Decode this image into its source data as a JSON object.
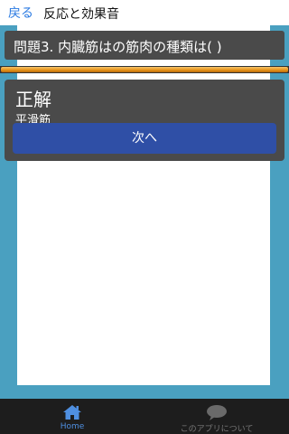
{
  "nav": {
    "back_label": "戻る",
    "title": "反応と効果音"
  },
  "question": {
    "text": "問題3. 内臓筋はの筋肉の種類は( )"
  },
  "progress": {
    "value": 1.0
  },
  "answer": {
    "result": "正解",
    "correct_answer": "平滑筋",
    "next_label": "次へ"
  },
  "tabbar": {
    "tabs": [
      {
        "label": "Home",
        "icon": "home-icon"
      },
      {
        "label": "このアプリについて",
        "icon": "chat-bubble-icon"
      }
    ]
  },
  "colors": {
    "background": "#4aa0c0",
    "accent": "#2a7ae2",
    "button": "#2f4fa6",
    "panel": "#4a4a4a",
    "progress": "#e8951c"
  }
}
